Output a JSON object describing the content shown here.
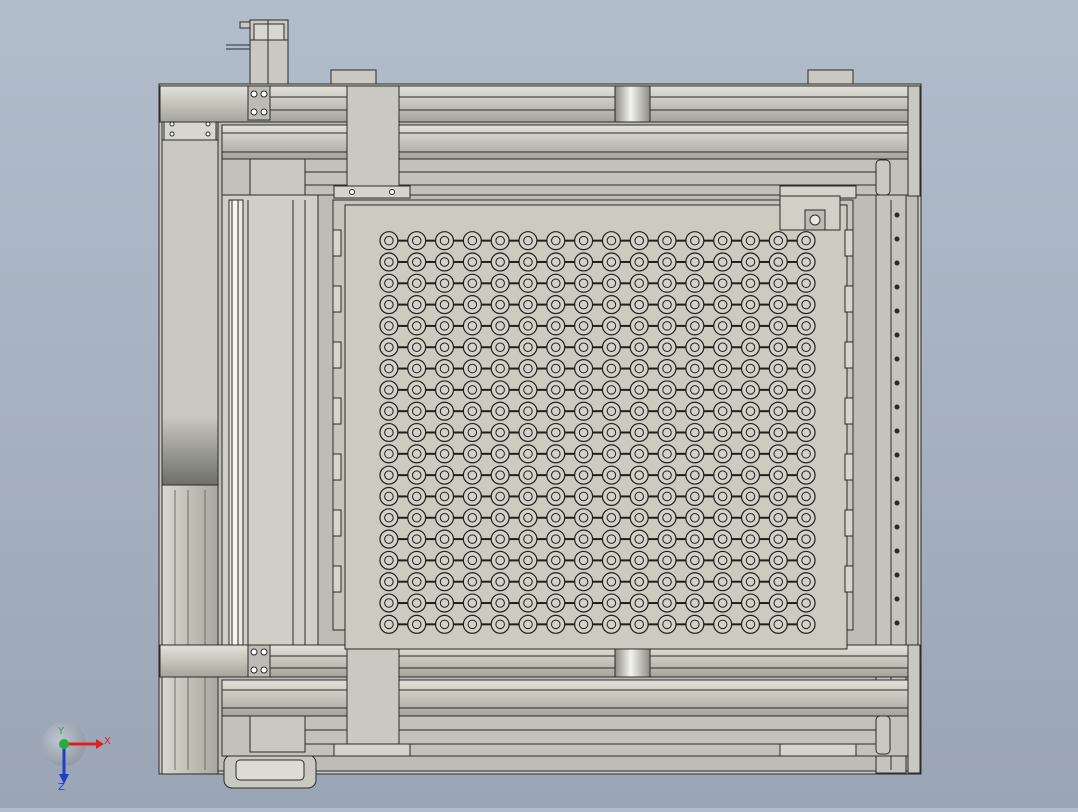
{
  "viewport": {
    "background_top": "#b2bdcc",
    "background_bottom": "#9aa5b6"
  },
  "model": {
    "description_icon": "cad-assembly-top-view",
    "frame_color": "#c9c9c1",
    "frame_shade": "#a9a9a1",
    "tray_color": "#c8c8bd",
    "edge_color": "#2b2b2b",
    "grid": {
      "rows": 19,
      "cols": 16
    },
    "clamp_count": 6
  },
  "triad": {
    "x_label": "X",
    "y_label": "Y",
    "z_label": "Z",
    "x_color": "#e0201d",
    "y_color": "#20b03a",
    "z_color": "#1f3fc8"
  }
}
